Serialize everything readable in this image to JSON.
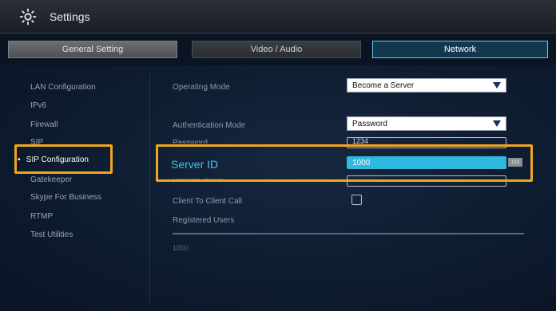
{
  "header": {
    "title": "Settings"
  },
  "tabs": [
    {
      "label": "General Setting"
    },
    {
      "label": "Video / Audio"
    },
    {
      "label": "Network"
    }
  ],
  "sidebar": {
    "items": [
      {
        "label": "LAN Configuration"
      },
      {
        "label": "IPv6"
      },
      {
        "label": "Firewall"
      },
      {
        "label": "SIP"
      },
      {
        "label": "SIP Configuration"
      },
      {
        "label": "Gatekeeper"
      },
      {
        "label": "Skype For Business"
      },
      {
        "label": "RTMP"
      },
      {
        "label": "Test Utilities"
      }
    ],
    "active_bullet": "•"
  },
  "form": {
    "operating_mode": {
      "label": "Operating Mode",
      "value": "Become a Server"
    },
    "authentication_mode": {
      "label": "Authentication Mode",
      "value": "Password"
    },
    "password": {
      "label": "Password",
      "value": "1234"
    },
    "server_id": {
      "label": "Server ID",
      "value": "1000",
      "keyboard_hint": "123"
    },
    "domain_name": {
      "label": "Domain Name",
      "value": ""
    },
    "client_to_client_call": {
      "label": "Client To Client Call",
      "checked": false
    },
    "registered_users": {
      "label": "Registered Users",
      "items": [
        "1000"
      ]
    }
  },
  "colors": {
    "highlight": "#f0a61f",
    "accent": "#2fb8e0",
    "label_accent": "#45c2ea",
    "background": "#0d1b2e"
  },
  "icons": {
    "settings": "gear-icon",
    "dropdown": "caret-down-icon"
  }
}
